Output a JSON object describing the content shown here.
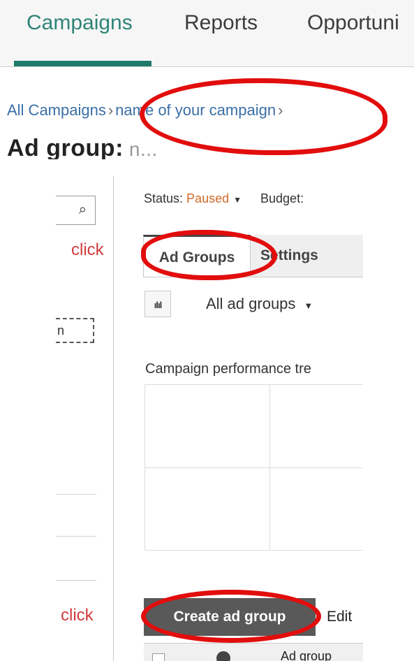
{
  "top_nav": {
    "tabs": [
      {
        "label": "Campaigns",
        "active": true
      },
      {
        "label": "Reports",
        "active": false
      },
      {
        "label": "Opportuni",
        "active": false
      }
    ]
  },
  "breadcrumb": {
    "root": "All Campaigns",
    "separator": "›",
    "current": "name of your campaign"
  },
  "page_title": {
    "label": "Ad group:",
    "value": "n..."
  },
  "left_pane": {
    "search_icon_glyph": "⌕",
    "dotted_button_label": "n"
  },
  "status_bar": {
    "status_label": "Status:",
    "status_value": "Paused",
    "budget_label": "Budget:"
  },
  "tabs": [
    {
      "label": "Ad Groups",
      "active": true
    },
    {
      "label": "Settings",
      "active": false
    }
  ],
  "filter": {
    "chart_icon_glyph": "ılıl",
    "selected": "All ad groups"
  },
  "trend": {
    "title": "Campaign performance tre"
  },
  "actions": {
    "create_label": "Create ad group",
    "edit_label": "Edit"
  },
  "table": {
    "name_header": "Ad group"
  },
  "annotations": {
    "click_label_1": "click",
    "click_label_2": "click",
    "highlight_color": "#e20d0d"
  },
  "colors": {
    "accent": "#1f7a69",
    "link": "#3a6fa6",
    "paused": "#d06a2a"
  }
}
